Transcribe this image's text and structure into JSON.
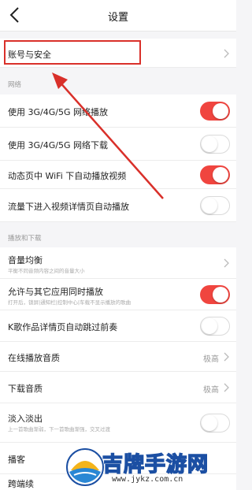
{
  "nav": {
    "title": "设置",
    "back_icon": "back-chevron-icon"
  },
  "account": {
    "label": "账号与安全"
  },
  "section_network": "网络",
  "network": [
    {
      "label": "使用 3G/4G/5G 网络播放",
      "on": true
    },
    {
      "label": "使用 3G/4G/5G 网络下载",
      "on": false
    },
    {
      "label": "动态页中 WiFi 下自动播放视频",
      "on": true
    },
    {
      "label": "流量下进入视频详情页自动播放",
      "on": false
    }
  ],
  "section_play": "播放和下载",
  "play": {
    "volume_label": "音量均衡",
    "volume_sub": "平衡不同音频内容之间的音量大小",
    "mix_label": "允许与其它应用同时播放",
    "mix_sub": "打开后，锁屏|通知栏|控制中心|车载不显示播放的歌曲",
    "mix_on": true,
    "skip_label": "K歌作品详情页自动跳过前奏",
    "skip_on": false,
    "online_quality_label": "在线播放音质",
    "online_quality_value": "极高",
    "download_quality_label": "下载音质",
    "download_quality_value": "极高",
    "fade_label": "淡入淡出",
    "fade_sub": "上一首歌曲渐弱，下一首歌曲渐强，交叉过渡",
    "fade_on": false,
    "partial_label_1": "播客",
    "partial_label_2": "跨端续"
  },
  "colors": {
    "accent": "#f0453f",
    "annotation": "#d9302a"
  },
  "watermark": {
    "text": "吉牌手游网",
    "url": "www.jykz.com.cn"
  }
}
